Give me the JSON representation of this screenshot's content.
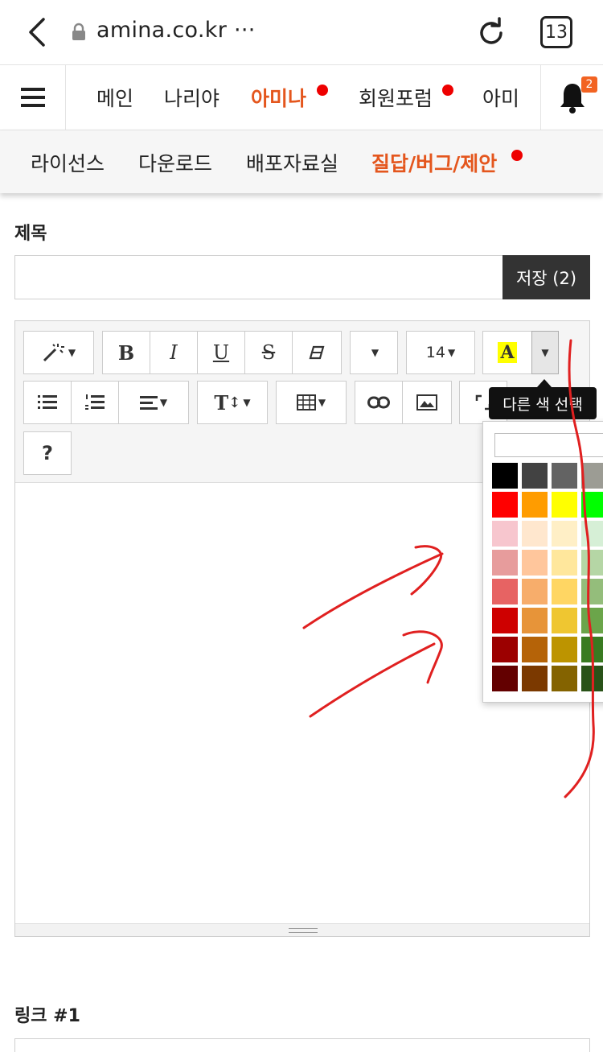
{
  "browser": {
    "url": "amina.co.kr ···",
    "tab_count": "13"
  },
  "header": {
    "nav": [
      {
        "label": "메인",
        "active": false,
        "dot": false
      },
      {
        "label": "나리야",
        "active": false,
        "dot": false
      },
      {
        "label": "아미나",
        "active": true,
        "dot": true
      },
      {
        "label": "회원포럼",
        "active": false,
        "dot": true
      },
      {
        "label": "아미",
        "active": false,
        "dot": false
      }
    ],
    "notification_count": "2"
  },
  "subnav": {
    "items": [
      {
        "label": "라이선스",
        "active": false
      },
      {
        "label": "다운로드",
        "active": false
      },
      {
        "label": "배포자료실",
        "active": false
      },
      {
        "label": "질답/버그/제안",
        "active": true
      }
    ]
  },
  "form": {
    "title_label": "제목",
    "title_value": "",
    "save_label": "저장 (2)",
    "link_label": "링크 #1"
  },
  "editor": {
    "font_size": "14",
    "color_letter": "A",
    "help_label": "?",
    "tooltip": "다른 색 선택",
    "tt_label": "T"
  },
  "colors": {
    "accent": "#e4561d",
    "dot": "#ee0000",
    "badge": "#f26322",
    "annotation": "#e02020",
    "swatches": [
      [
        "#000000",
        "#424242",
        "#636363",
        "#9c9c94"
      ],
      [
        "#ff0000",
        "#ff9c00",
        "#ffff00",
        "#00ff00"
      ],
      [
        "#f7c6ce",
        "#ffe7ce",
        "#ffefc6",
        "#d6efd6"
      ],
      [
        "#e79c9c",
        "#ffc69c",
        "#ffe79c",
        "#b5d6a5"
      ],
      [
        "#e76363",
        "#f7ad6b",
        "#ffd663",
        "#94bd7b"
      ],
      [
        "#ce0000",
        "#e79439",
        "#efc631",
        "#6ba54a"
      ],
      [
        "#9c0000",
        "#b56308",
        "#bd9400",
        "#397b21"
      ],
      [
        "#630000",
        "#7b3900",
        "#846300",
        "#295218"
      ]
    ]
  }
}
